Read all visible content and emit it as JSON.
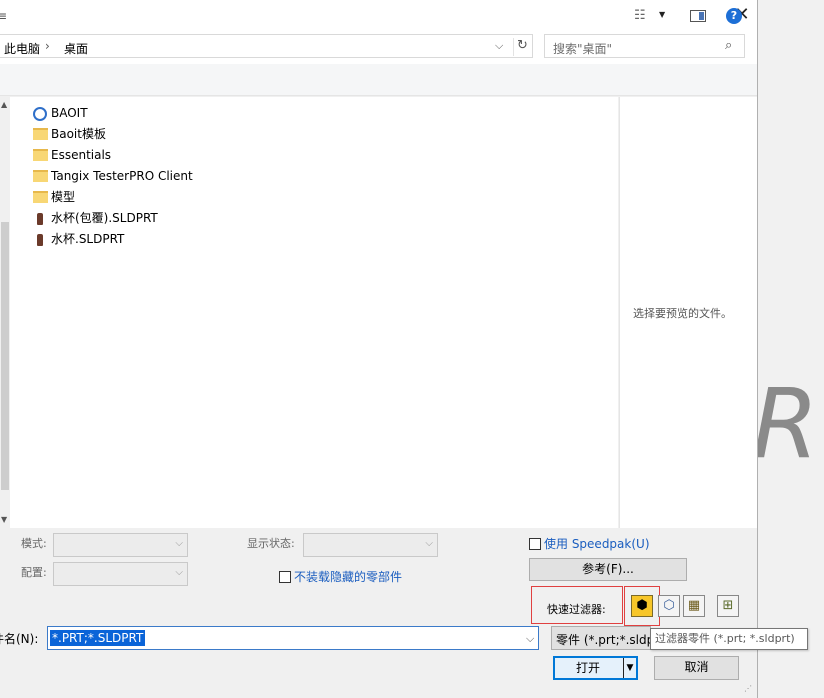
{
  "background_app": {
    "partial_text": "R"
  },
  "titlebar": {
    "close_glyph": "✕"
  },
  "address_bar": {
    "crumbs": [
      "此电脑",
      "桌面"
    ],
    "separator": "›",
    "dropdown_glyph": "⌵",
    "refresh_glyph": "↻"
  },
  "search": {
    "placeholder": "搜索\"桌面\"",
    "icon_glyph": "⌕"
  },
  "toolbar": {
    "organize_glyph": "≡",
    "view_glyph": "☷",
    "view_arrow": "▼",
    "help_glyph": "?"
  },
  "files": [
    {
      "name": "BAOIT",
      "icon": "ie-shortcut-icon"
    },
    {
      "name": "Baoit模板",
      "icon": "folder-icon"
    },
    {
      "name": "Essentials",
      "icon": "folder-icon"
    },
    {
      "name": "Tangix TesterPRO Client",
      "icon": "folder-icon"
    },
    {
      "name": "模型",
      "icon": "folder-icon"
    },
    {
      "name": "水杯(包覆).SLDPRT",
      "icon": "sldprt-icon"
    },
    {
      "name": "水杯.SLDPRT",
      "icon": "sldprt-icon"
    }
  ],
  "scroll": {
    "up": "▲",
    "down": "▼"
  },
  "preview": {
    "message": "选择要预览的文件。"
  },
  "options": {
    "mode_label": "模式:",
    "config_label": "配置:",
    "display_state_label": "显示状态:",
    "dropdown_glyph": "⌵",
    "no_load_hidden": "不装载隐藏的零部件",
    "use_speedpak": "使用 Speedpak(U)",
    "reference_button": "参考(F)..."
  },
  "quick_filter": {
    "label": "快速过滤器:",
    "buttons": [
      {
        "name": "filter-parts",
        "glyph": "⬢"
      },
      {
        "name": "filter-assemblies",
        "glyph": "⬡"
      },
      {
        "name": "filter-drawings",
        "glyph": "▦"
      },
      {
        "name": "filter-top-level-assemblies",
        "glyph": "⊞"
      }
    ],
    "tooltip": "过滤器零件 (*.prt; *.sldprt)"
  },
  "filename": {
    "label": "件名(N):",
    "value": "*.PRT;*.SLDPRT",
    "dropdown_glyph": "⌵"
  },
  "filetype": {
    "value": "零件 (*.prt;*.sldp"
  },
  "buttons": {
    "open": "打开",
    "open_split": "▼",
    "cancel": "取消"
  },
  "resize_grip": "⋰"
}
